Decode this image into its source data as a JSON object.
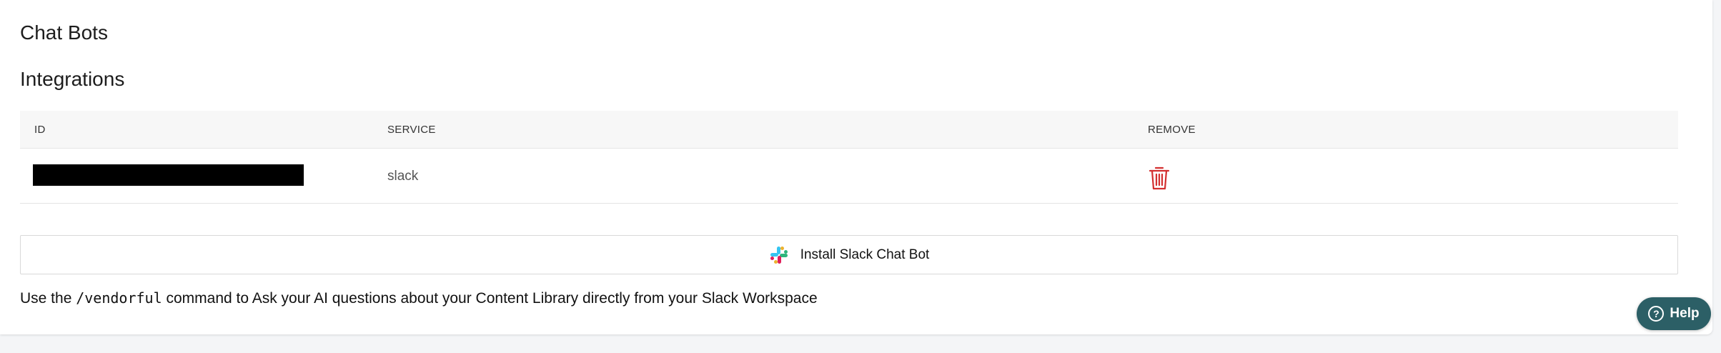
{
  "page": {
    "section_title": "Chat Bots",
    "integrations_title": "Integrations"
  },
  "table": {
    "headers": {
      "id": "ID",
      "service": "SERVICE",
      "remove": "REMOVE"
    },
    "rows": [
      {
        "id": "",
        "service": "slack"
      }
    ]
  },
  "install_button": {
    "label": "Install Slack Chat Bot",
    "icon": "slack-icon"
  },
  "hint": {
    "prefix": "Use the ",
    "command": "/vendorful",
    "suffix": " command to Ask your AI questions about your Content Library directly from your Slack Workspace"
  },
  "help": {
    "label": "Help",
    "icon": "question-circle-icon"
  },
  "colors": {
    "trash": "#d32f2f",
    "help_bg": "#2c5f66"
  }
}
